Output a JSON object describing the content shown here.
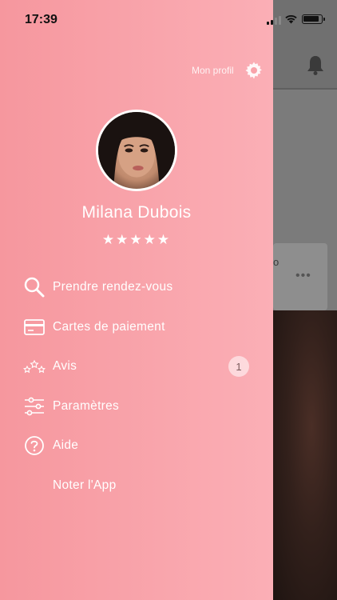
{
  "status_bar": {
    "time": "17:39"
  },
  "header": {
    "profile_label": "Mon profil"
  },
  "profile": {
    "name": "Milana Dubois",
    "rating_stars": "★★★★★",
    "rating": 5
  },
  "menu": [
    {
      "label": "Prendre rendez-vous",
      "icon": "search-icon"
    },
    {
      "label": "Cartes de paiement",
      "icon": "credit-card-icon"
    },
    {
      "label": "Avis",
      "icon": "stars-icon",
      "badge": "1"
    },
    {
      "label": "Paramètres",
      "icon": "sliders-icon"
    },
    {
      "label": "Aide",
      "icon": "help-icon"
    },
    {
      "label": "Noter l'App",
      "icon": ""
    }
  ],
  "background": {
    "card_text": "o",
    "card_menu": "•••"
  },
  "colors": {
    "drawer_start": "#f6979e",
    "drawer_end": "#fbafb6",
    "text": "#ffffff"
  }
}
